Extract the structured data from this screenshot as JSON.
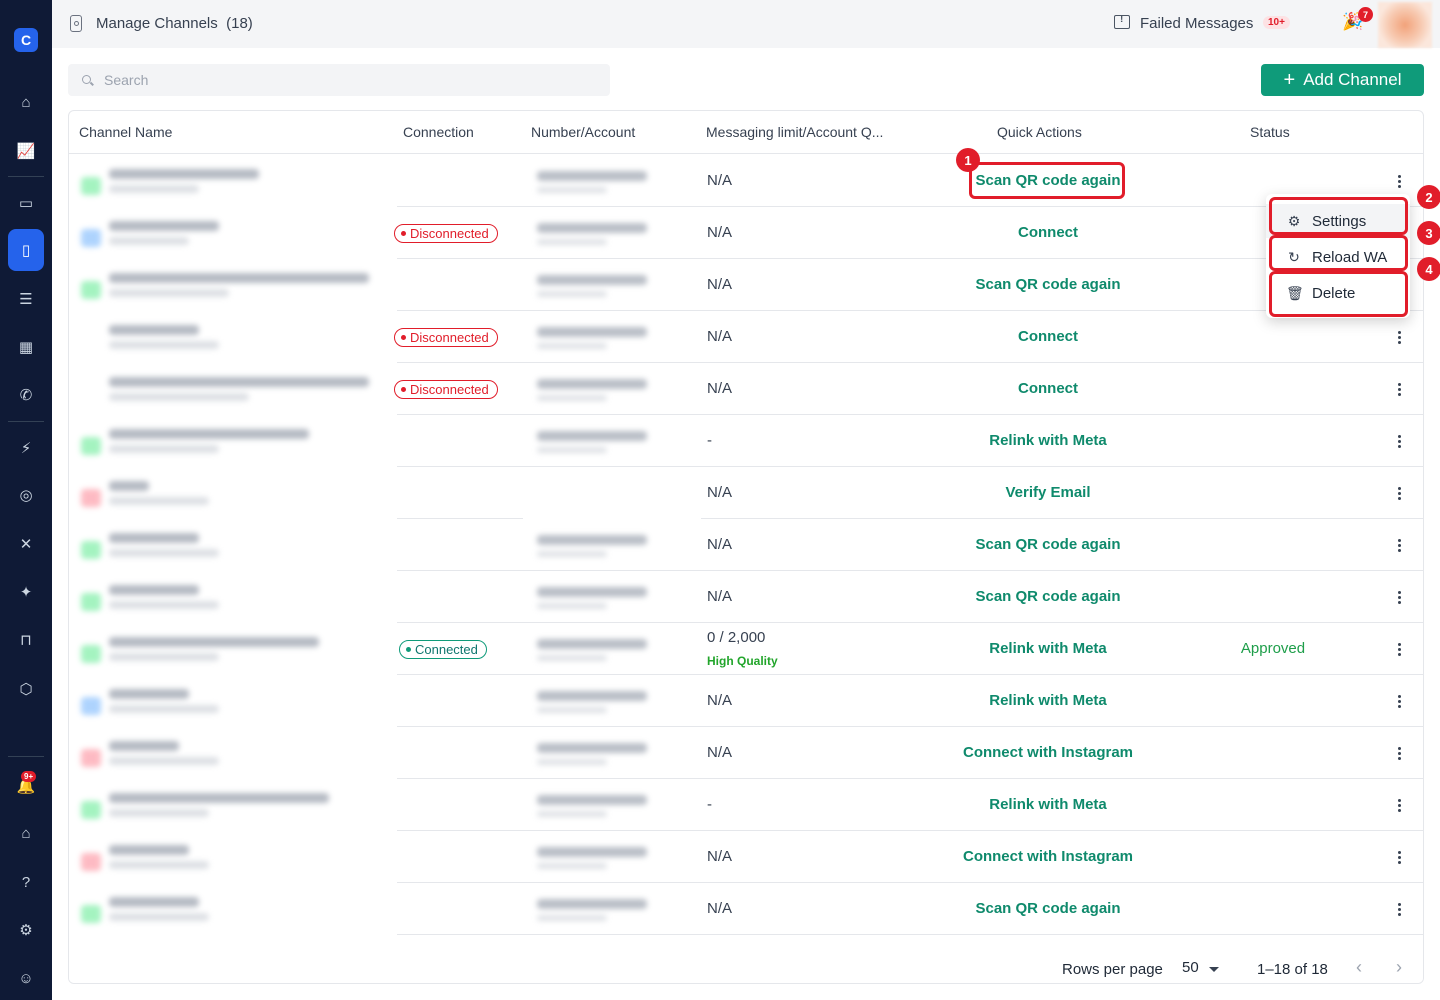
{
  "sidebar": {
    "logo_glyph": "C",
    "items": [
      {
        "icon": "home-icon",
        "glyph": "⌂",
        "active": false
      },
      {
        "icon": "analytics-icon",
        "glyph": "📈",
        "active": false
      },
      {
        "icon": "inbox-icon",
        "glyph": "▭",
        "active": false
      },
      {
        "icon": "channels-icon",
        "glyph": "▯",
        "active": true
      },
      {
        "icon": "contacts-icon",
        "glyph": "☰",
        "active": false
      },
      {
        "icon": "board-icon",
        "glyph": "▦",
        "active": false
      },
      {
        "icon": "phone-icon",
        "glyph": "✆",
        "active": false
      },
      {
        "icon": "automation-icon",
        "glyph": "⚡",
        "active": false
      },
      {
        "icon": "broadcast-icon",
        "glyph": "◎",
        "active": false
      },
      {
        "icon": "tools-icon",
        "glyph": "✕",
        "active": false
      },
      {
        "icon": "ai-sparkle-icon",
        "glyph": "✦",
        "active": false
      },
      {
        "icon": "bag-icon",
        "glyph": "⊓",
        "active": false
      },
      {
        "icon": "package-icon",
        "glyph": "⬡",
        "active": false
      },
      {
        "icon": "bell-icon",
        "glyph": "🔔",
        "active": false
      },
      {
        "icon": "academy-icon",
        "glyph": "⌂",
        "active": false
      },
      {
        "icon": "help-icon",
        "glyph": "?",
        "active": false
      },
      {
        "icon": "gear-icon",
        "glyph": "⚙",
        "active": false
      },
      {
        "icon": "user-settings-icon",
        "glyph": "☺",
        "active": false
      }
    ],
    "notification_badge": "9+"
  },
  "topbar": {
    "title": "Manage Channels",
    "count": "(18)",
    "failed_label": "Failed Messages",
    "failed_badge": "10+",
    "party_badge": "7"
  },
  "search": {
    "placeholder": "Search",
    "value": ""
  },
  "add_button": {
    "label": "Add Channel"
  },
  "table": {
    "columns": [
      "Channel Name",
      "Connection",
      "Number/Account",
      "Messaging limit/Account Q...",
      "Quick Actions",
      "Status"
    ],
    "rows": [
      {
        "connection": "",
        "limit": "N/A",
        "quality": "",
        "action": "Scan QR code again",
        "status": "",
        "color": "#86efac",
        "has_number": true
      },
      {
        "connection": "Disconnected",
        "limit": "N/A",
        "quality": "",
        "action": "Connect",
        "status": "",
        "color": "#93c5fd",
        "has_number": true
      },
      {
        "connection": "",
        "limit": "N/A",
        "quality": "",
        "action": "Scan QR code again",
        "status": "",
        "color": "#86efac",
        "has_number": true
      },
      {
        "connection": "Disconnected",
        "limit": "N/A",
        "quality": "",
        "action": "Connect",
        "status": "",
        "color": "",
        "has_number": true
      },
      {
        "connection": "Disconnected",
        "limit": "N/A",
        "quality": "",
        "action": "Connect",
        "status": "",
        "color": "",
        "has_number": true
      },
      {
        "connection": "",
        "limit": "-",
        "quality": "",
        "action": "Relink with Meta",
        "status": "",
        "color": "#86efac",
        "has_number": true
      },
      {
        "connection": "",
        "limit": "N/A",
        "quality": "",
        "action": "Verify Email",
        "status": "",
        "color": "#fda4af",
        "has_number": false
      },
      {
        "connection": "",
        "limit": "N/A",
        "quality": "",
        "action": "Scan QR code again",
        "status": "",
        "color": "#86efac",
        "has_number": true
      },
      {
        "connection": "",
        "limit": "N/A",
        "quality": "",
        "action": "Scan QR code again",
        "status": "",
        "color": "#86efac",
        "has_number": true
      },
      {
        "connection": "Connected",
        "limit": "0 / 2,000",
        "quality": "High Quality",
        "action": "Relink with Meta",
        "status": "Approved",
        "color": "#86efac",
        "has_number": true
      },
      {
        "connection": "",
        "limit": "N/A",
        "quality": "",
        "action": "Relink with Meta",
        "status": "",
        "color": "#93c5fd",
        "has_number": true
      },
      {
        "connection": "",
        "limit": "N/A",
        "quality": "",
        "action": "Connect with Instagram",
        "status": "",
        "color": "#fda4af",
        "has_number": true
      },
      {
        "connection": "",
        "limit": "-",
        "quality": "",
        "action": "Relink with Meta",
        "status": "",
        "color": "#86efac",
        "has_number": true
      },
      {
        "connection": "",
        "limit": "N/A",
        "quality": "",
        "action": "Connect with Instagram",
        "status": "",
        "color": "#fda4af",
        "has_number": true
      },
      {
        "connection": "",
        "limit": "N/A",
        "quality": "",
        "action": "Scan QR code again",
        "status": "",
        "color": "#86efac",
        "has_number": true
      }
    ]
  },
  "row_menu": {
    "items": [
      {
        "label": "Settings",
        "icon": "settings-icon",
        "glyph": "⚙"
      },
      {
        "label": "Reload WA",
        "icon": "reload-icon",
        "glyph": "↻"
      },
      {
        "label": "Delete",
        "icon": "trash-icon",
        "glyph": "🗑"
      }
    ]
  },
  "annotations": [
    "1",
    "2",
    "3",
    "4"
  ],
  "pagination": {
    "rows_per_page_label": "Rows per page",
    "rows_per_page_value": "50",
    "range": "1–18 of 18",
    "prev_glyph": "‹",
    "next_glyph": "›"
  },
  "colors": {
    "accent": "#0f9b7a",
    "action_text": "#0f8a6c",
    "disconnected": "#e11d2a",
    "sidebar": "#0f1a36",
    "active_nav": "#2563eb"
  }
}
